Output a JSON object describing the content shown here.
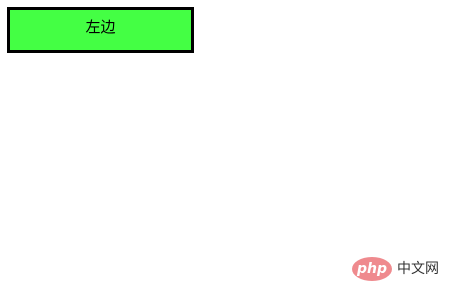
{
  "box": {
    "label": "左边",
    "fill_color": "#44ff44",
    "border_color": "#000000"
  },
  "watermark": {
    "logo_text": "php",
    "site_text": "中文网",
    "logo_color": "#ef8a8e"
  }
}
